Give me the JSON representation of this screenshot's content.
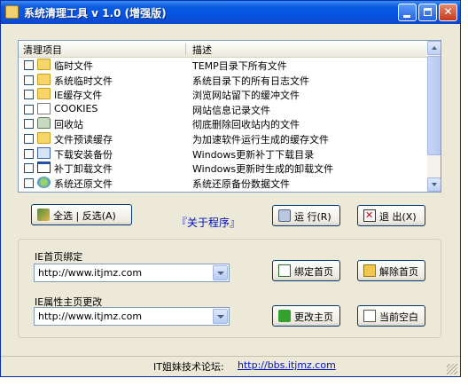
{
  "window": {
    "title": "系统清理工具 v 1.0 (增强版)"
  },
  "list": {
    "headers": [
      "清理项目",
      "描述"
    ],
    "rows": [
      {
        "name": "临时文件",
        "desc": "TEMP目录下所有文件",
        "icon": "folder-icon"
      },
      {
        "name": "系统临时文件",
        "desc": "系统目录下的所有日志文件",
        "icon": "folder-icon"
      },
      {
        "name": "IE缓存文件",
        "desc": "浏览网站留下的缓冲文件",
        "icon": "folder-icon"
      },
      {
        "name": "COOKIES",
        "desc": "网站信息记录文件",
        "icon": "cookie-icon"
      },
      {
        "name": "回收站",
        "desc": "彻底删除回收站内的文件",
        "icon": "recycle-bin-icon"
      },
      {
        "name": "文件预读缓存",
        "desc": "为加速软件运行生成的缓存文件",
        "icon": "folder-icon"
      },
      {
        "name": "下载安装备份",
        "desc": "Windows更新补丁下载目录",
        "icon": "download-icon"
      },
      {
        "name": "补丁卸载文件",
        "desc": "Windows更新时生成的卸载文件",
        "icon": "patch-icon"
      },
      {
        "name": "系统还原文件",
        "desc": "系统还原备份数据文件",
        "icon": "restore-icon"
      }
    ]
  },
  "buttons": {
    "select_all": "全选 | 反选(A)",
    "run": "运 行(R)",
    "exit": "退 出(X)",
    "bind_home": "绑定首页",
    "unbind_home": "解除首页",
    "change_home": "更改主页",
    "current_blank": "当前空白"
  },
  "about": "『关于程序』",
  "ie": {
    "home_label": "IE首页绑定",
    "home_value": "http://www.itjmz.com",
    "change_label": "IE属性主页更改",
    "change_value": "http://www.itjmz.com"
  },
  "status": {
    "forum_label": "IT姐妹技术论坛:",
    "forum_url": "http://bbs.itjmz.com"
  }
}
